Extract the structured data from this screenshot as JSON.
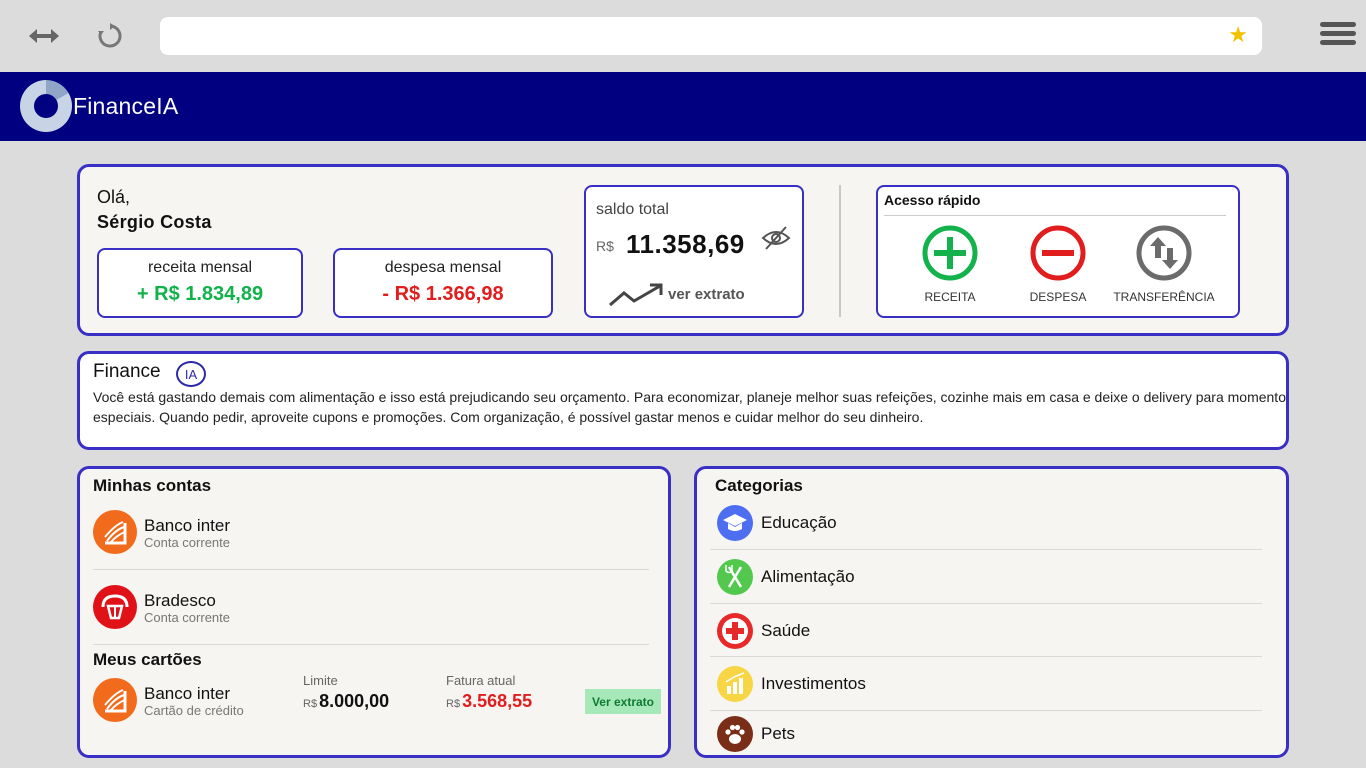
{
  "header": {
    "app_name": "FinanceIA"
  },
  "greeting": {
    "hello": "Olá,",
    "user_name": "Sérgio Costa"
  },
  "income": {
    "label": "receita mensal",
    "value": "+ R$ 1.834,89"
  },
  "expense": {
    "label": "despesa mensal",
    "value": "- R$ 1.366,98"
  },
  "balance": {
    "label": "saldo total",
    "currency": "R$",
    "amount": "11.358,69",
    "statement_link": "ver extrato"
  },
  "quick_access": {
    "title": "Acesso rápido",
    "actions": [
      {
        "label": "RECEITA",
        "icon": "plus-circle-icon",
        "color": "#14b24c"
      },
      {
        "label": "DESPESA",
        "icon": "minus-circle-icon",
        "color": "#e11d1d"
      },
      {
        "label": "TRANSFERÊNCIA",
        "icon": "transfer-arrows-icon",
        "color": "#6b6b6b"
      }
    ]
  },
  "ai": {
    "title": "Finance",
    "badge": "IA",
    "message": "Você está gastando demais com alimentação e isso está prejudicando seu orçamento. Para economizar, planeje melhor suas refeições, cozinhe mais em casa e deixe o delivery para momentos especiais. Quando pedir, aproveite cupons e promoções. Com organização, é possível gastar menos e cuidar melhor do seu dinheiro."
  },
  "accounts": {
    "title": "Minhas contas",
    "items": [
      {
        "name": "Banco inter",
        "type": "Conta corrente"
      },
      {
        "name": "Bradesco",
        "type": "Conta corrente"
      }
    ]
  },
  "cards": {
    "title": "Meus cartões",
    "items": [
      {
        "name": "Banco inter",
        "type": "Cartão de crédito",
        "limit_label": "Limite",
        "limit_currency": "R$",
        "limit_value": "8.000,00",
        "invoice_label": "Fatura atual",
        "invoice_currency": "R$",
        "invoice_value": "3.568,55",
        "button_label": "Ver extrato"
      }
    ]
  },
  "categories": {
    "title": "Categorias",
    "items": [
      {
        "name": "Educação",
        "icon": "graduation-cap-icon",
        "color": "#4e6ef2"
      },
      {
        "name": "Alimentação",
        "icon": "fork-knife-icon",
        "color": "#52c94e"
      },
      {
        "name": "Saúde",
        "icon": "medical-cross-icon",
        "color": "#e62a2a"
      },
      {
        "name": "Investimentos",
        "icon": "bar-chart-icon",
        "color": "#f7d545"
      },
      {
        "name": "Pets",
        "icon": "paw-icon",
        "color": "#7a2e17"
      }
    ]
  },
  "colors": {
    "primary": "#000080",
    "accent_border": "#3a2fc4",
    "income": "#12b24b",
    "expense": "#e11d1d"
  }
}
